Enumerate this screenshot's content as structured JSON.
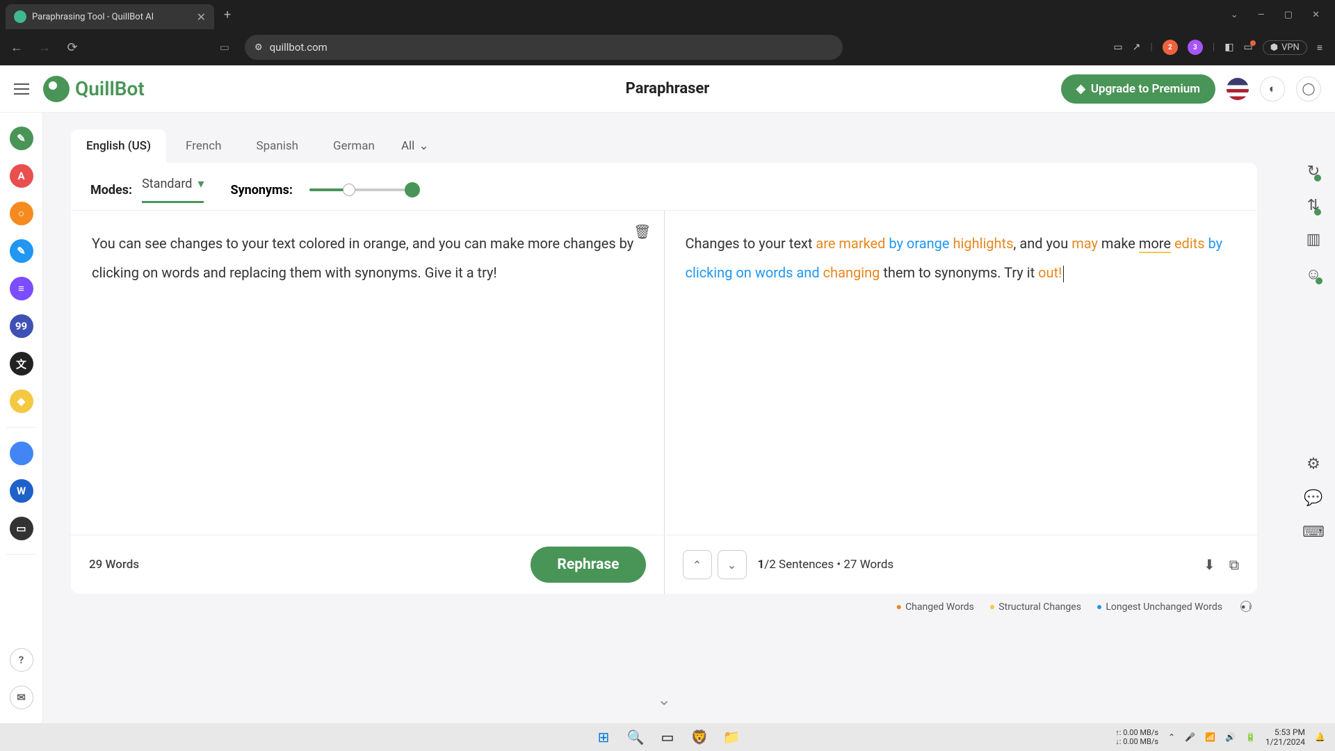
{
  "browser": {
    "tab_title": "Paraphrasing Tool - QuillBot AI",
    "url": "quillbot.com",
    "vpn_label": "VPN"
  },
  "header": {
    "brand": "QuillBot",
    "title": "Paraphraser",
    "upgrade": "Upgrade to Premium"
  },
  "lang_tabs": {
    "en": "English (US)",
    "fr": "French",
    "es": "Spanish",
    "de": "German",
    "all": "All"
  },
  "modes": {
    "label": "Modes:",
    "selected": "Standard",
    "synonyms_label": "Synonyms:"
  },
  "input": {
    "text": "You can see changes to your text colored in orange, and you can make more changes by clicking on words and replacing them with synonyms. Give it a try!",
    "word_count": "29 Words",
    "rephrase": "Rephrase"
  },
  "output": {
    "tokens": [
      {
        "t": "Changes to your text ",
        "cls": ""
      },
      {
        "t": "are marked",
        "cls": "c-orange"
      },
      {
        "t": " by orange ",
        "cls": "c-blue"
      },
      {
        "t": "highlights",
        "cls": "c-orange"
      },
      {
        "t": ", and you ",
        "cls": ""
      },
      {
        "t": "may",
        "cls": "c-orange"
      },
      {
        "t": " make ",
        "cls": ""
      },
      {
        "t": "more",
        "cls": "u-yellow"
      },
      {
        "t": " ",
        "cls": ""
      },
      {
        "t": "edits",
        "cls": "c-orange"
      },
      {
        "t": " by clicking on words and ",
        "cls": "c-blue"
      },
      {
        "t": "changing",
        "cls": "c-orange"
      },
      {
        "t": " them to synonyms. Try it ",
        "cls": ""
      },
      {
        "t": "out!",
        "cls": "c-orange"
      }
    ],
    "sentence_info_bold": "1",
    "sentence_info_rest": "/2 Sentences  •  27 Words"
  },
  "legend": {
    "changed": "Changed Words",
    "structural": "Structural Changes",
    "unchanged": "Longest Unchanged Words"
  },
  "taskbar": {
    "net_up": "↑: 0.00 MB/s",
    "net_down": "↓: 0.00 MB/s",
    "time": "5:53 PM",
    "date": "1/21/2024"
  },
  "rail_colors": [
    "#499557",
    "#e94f4f",
    "#f58b1f",
    "#2196f3",
    "#7c4dff",
    "#3f51b5",
    "#222",
    "#f5c842",
    "#4285f4",
    "#1e62c9",
    "#333"
  ],
  "rail_labels": [
    "✎",
    "A",
    "○",
    "✎",
    "≡",
    "99",
    "文",
    "◆",
    "",
    "W",
    "▭"
  ]
}
